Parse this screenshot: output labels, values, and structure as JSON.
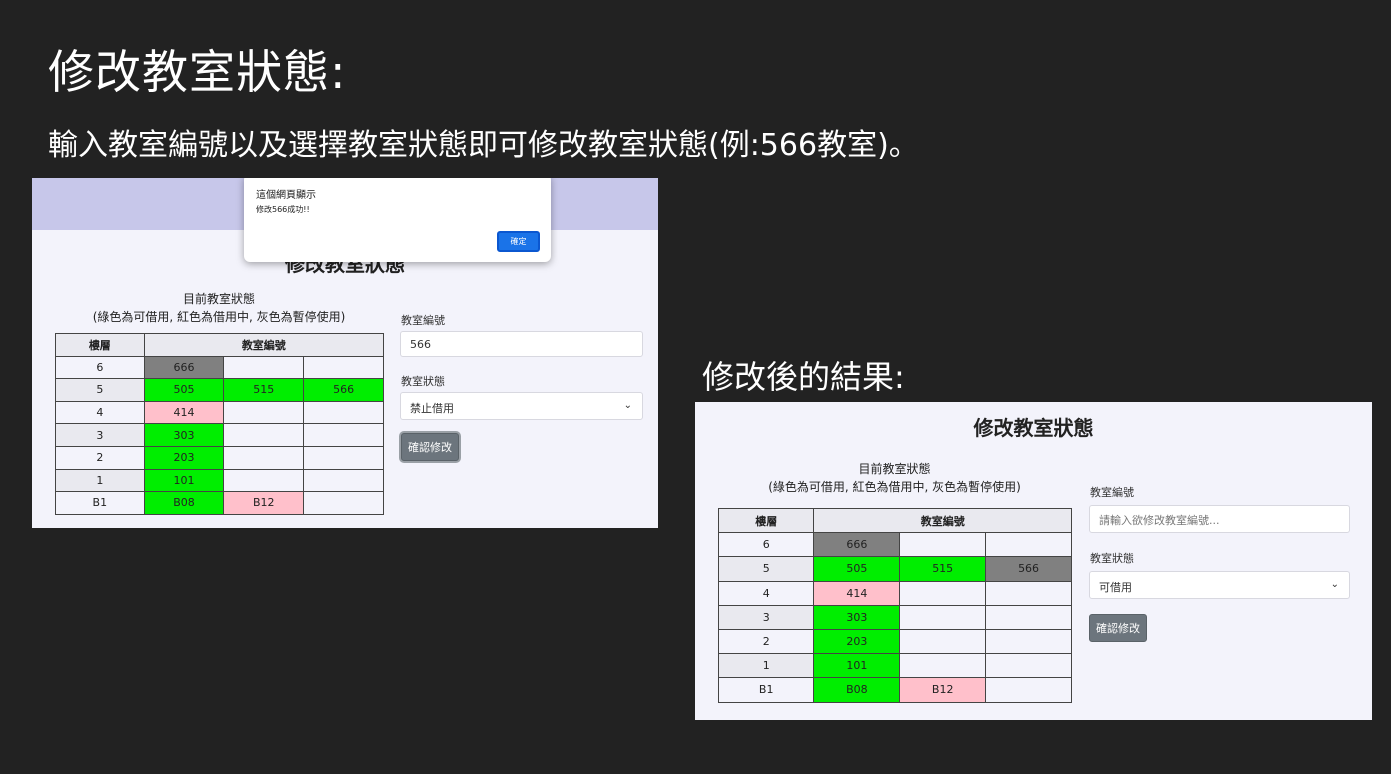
{
  "slide": {
    "title": "修改教室狀態:",
    "subtitle": "輸入教室編號以及選擇教室狀態即可修改教室狀態(例:566教室)。",
    "result_label": "修改後的結果:"
  },
  "before": {
    "page_heading": "修改教室狀態",
    "caption_line1": "目前教室狀態",
    "caption_line2": "(綠色為可借用, 紅色為借用中, 灰色為暫停使用)",
    "table_headers": [
      "樓層",
      "教室編號"
    ],
    "rows": [
      {
        "floor": "6",
        "rooms": [
          {
            "num": "666",
            "status": "gray"
          },
          {
            "num": "",
            "status": ""
          },
          {
            "num": "",
            "status": ""
          }
        ]
      },
      {
        "floor": "5",
        "rooms": [
          {
            "num": "505",
            "status": "green"
          },
          {
            "num": "515",
            "status": "green"
          },
          {
            "num": "566",
            "status": "green"
          }
        ]
      },
      {
        "floor": "4",
        "rooms": [
          {
            "num": "414",
            "status": "pink"
          },
          {
            "num": "",
            "status": ""
          },
          {
            "num": "",
            "status": ""
          }
        ]
      },
      {
        "floor": "3",
        "rooms": [
          {
            "num": "303",
            "status": "green"
          },
          {
            "num": "",
            "status": ""
          },
          {
            "num": "",
            "status": ""
          }
        ]
      },
      {
        "floor": "2",
        "rooms": [
          {
            "num": "203",
            "status": "green"
          },
          {
            "num": "",
            "status": ""
          },
          {
            "num": "",
            "status": ""
          }
        ]
      },
      {
        "floor": "1",
        "rooms": [
          {
            "num": "101",
            "status": "green"
          },
          {
            "num": "",
            "status": ""
          },
          {
            "num": "",
            "status": ""
          }
        ]
      },
      {
        "floor": "B1",
        "rooms": [
          {
            "num": "B08",
            "status": "green"
          },
          {
            "num": "B12",
            "status": "pink"
          },
          {
            "num": "",
            "status": ""
          }
        ]
      }
    ],
    "form": {
      "room_label": "教室編號",
      "room_value": "566",
      "status_label": "教室狀態",
      "status_selected": "禁止借用",
      "confirm_label": "確認修改"
    },
    "alert": {
      "title": "這個網頁顯示",
      "message": "修改566成功!!",
      "ok_label": "確定"
    }
  },
  "after": {
    "page_heading": "修改教室狀態",
    "caption_line1": "目前教室狀態",
    "caption_line2": "(綠色為可借用, 紅色為借用中, 灰色為暫停使用)",
    "table_headers": [
      "樓層",
      "教室編號"
    ],
    "rows": [
      {
        "floor": "6",
        "rooms": [
          {
            "num": "666",
            "status": "gray"
          },
          {
            "num": "",
            "status": ""
          },
          {
            "num": "",
            "status": ""
          }
        ]
      },
      {
        "floor": "5",
        "rooms": [
          {
            "num": "505",
            "status": "green"
          },
          {
            "num": "515",
            "status": "green"
          },
          {
            "num": "566",
            "status": "gray"
          }
        ]
      },
      {
        "floor": "4",
        "rooms": [
          {
            "num": "414",
            "status": "pink"
          },
          {
            "num": "",
            "status": ""
          },
          {
            "num": "",
            "status": ""
          }
        ]
      },
      {
        "floor": "3",
        "rooms": [
          {
            "num": "303",
            "status": "green"
          },
          {
            "num": "",
            "status": ""
          },
          {
            "num": "",
            "status": ""
          }
        ]
      },
      {
        "floor": "2",
        "rooms": [
          {
            "num": "203",
            "status": "green"
          },
          {
            "num": "",
            "status": ""
          },
          {
            "num": "",
            "status": ""
          }
        ]
      },
      {
        "floor": "1",
        "rooms": [
          {
            "num": "101",
            "status": "green"
          },
          {
            "num": "",
            "status": ""
          },
          {
            "num": "",
            "status": ""
          }
        ]
      },
      {
        "floor": "B1",
        "rooms": [
          {
            "num": "B08",
            "status": "green"
          },
          {
            "num": "B12",
            "status": "pink"
          },
          {
            "num": "",
            "status": ""
          }
        ]
      }
    ],
    "form": {
      "room_label": "教室編號",
      "room_placeholder": "請輸入欲修改教室編號...",
      "status_label": "教室狀態",
      "status_selected": "可借用",
      "confirm_label": "確認修改"
    }
  },
  "colors": {
    "green": "#00ee00",
    "pink": "#ffc0cb",
    "gray": "#808080",
    "background": "#222222",
    "header_band": "#c7c7ea"
  }
}
